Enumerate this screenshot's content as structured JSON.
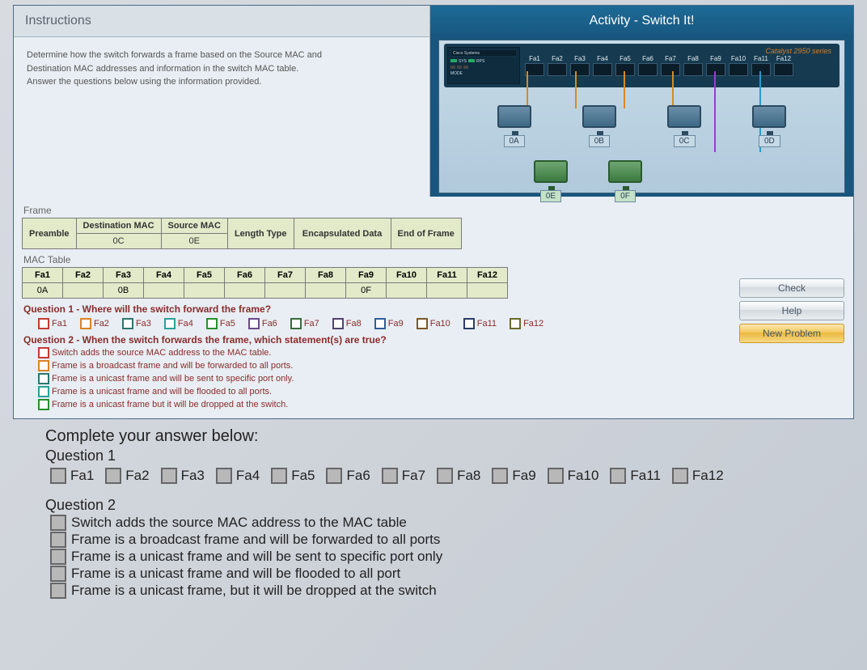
{
  "panel": {
    "instructions_title": "Instructions",
    "instructions_body_l1": "Determine how the switch forwards a frame based on the Source MAC and",
    "instructions_body_l2": "Destination MAC addresses and information in the switch MAC table.",
    "instructions_body_l3": "Answer the questions below using the information provided.",
    "activity_title": "Activity - Switch It!"
  },
  "switch": {
    "brand": "Catalyst 2950 series",
    "ports": [
      "Fa1",
      "Fa2",
      "Fa3",
      "Fa4",
      "Fa5",
      "Fa6",
      "Fa7",
      "Fa8",
      "Fa9",
      "Fa10",
      "Fa11",
      "Fa12"
    ],
    "computers_top": [
      "0A",
      "0B",
      "0C",
      "0D"
    ],
    "computers_bottom": [
      "0E",
      "0F"
    ]
  },
  "frame_section": {
    "label": "Frame",
    "headers": [
      "Preamble",
      "Destination MAC",
      "Source MAC",
      "Length Type",
      "Encapsulated Data",
      "End of Frame"
    ],
    "values": {
      "dest": "0C",
      "src": "0E"
    }
  },
  "mac_table": {
    "label": "MAC Table",
    "ports": [
      "Fa1",
      "Fa2",
      "Fa3",
      "Fa4",
      "Fa5",
      "Fa6",
      "Fa7",
      "Fa8",
      "Fa9",
      "Fa10",
      "Fa11",
      "Fa12"
    ],
    "entries": {
      "Fa1": "0A",
      "Fa3": "0B",
      "Fa9": "0F"
    }
  },
  "q1": {
    "text": "Question 1 - Where will the switch forward the frame?",
    "options": [
      "Fa1",
      "Fa2",
      "Fa3",
      "Fa4",
      "Fa5",
      "Fa6",
      "Fa7",
      "Fa8",
      "Fa9",
      "Fa10",
      "Fa11",
      "Fa12"
    ]
  },
  "q2": {
    "text": "Question 2 - When the switch forwards the frame, which statement(s) are true?",
    "stmts": [
      "Switch adds the source MAC address to the MAC table.",
      "Frame is a broadcast frame and will be forwarded to all ports.",
      "Frame is a unicast frame and will be sent to specific port only.",
      "Frame is a unicast frame and will be flooded to all ports.",
      "Frame is a unicast frame but it will be dropped at the switch."
    ]
  },
  "buttons": {
    "check": "Check",
    "help": "Help",
    "new": "New Problem"
  },
  "lower": {
    "complete": "Complete your answer below:",
    "q1": "Question 1",
    "q1_opts": [
      "Fa1",
      "Fa2",
      "Fa3",
      "Fa4",
      "Fa5",
      "Fa6",
      "Fa7",
      "Fa8",
      "Fa9",
      "Fa10",
      "Fa11",
      "Fa12"
    ],
    "q2": "Question 2",
    "q2_stmts": [
      "Switch adds the source MAC address to the MAC table",
      "Frame is a broadcast frame and will be forwarded to all ports",
      "Frame is a unicast frame and will be sent to specific port only",
      "Frame is a unicast frame and will be flooded to all port",
      "Frame is a unicast frame, but it will be dropped at the switch"
    ]
  },
  "cb_colors": [
    "c-red",
    "c-orange",
    "c-dteal",
    "c-teal",
    "c-green",
    "c-purple",
    "c-dgreen",
    "c-dpurp",
    "c-blue",
    "c-brown",
    "c-navy",
    "c-olive"
  ]
}
